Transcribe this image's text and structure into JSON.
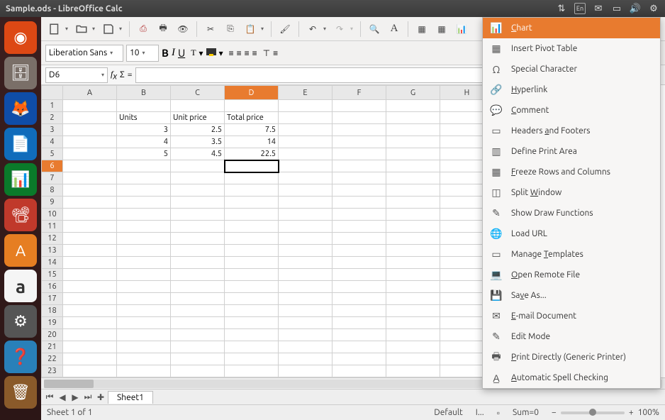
{
  "window_title": "Sample.ods - LibreOffice Calc",
  "sys_icons": [
    "network",
    "keyboard",
    "mail",
    "battery",
    "volume",
    "settings"
  ],
  "launcher": [
    {
      "name": "ubuntu",
      "bg": "#dd4814"
    },
    {
      "name": "files",
      "bg": "#7a6f68"
    },
    {
      "name": "firefox",
      "bg": "#0f4da8"
    },
    {
      "name": "writer",
      "bg": "#106cbb"
    },
    {
      "name": "calc",
      "bg": "#0a7a2a"
    },
    {
      "name": "impress",
      "bg": "#c0392b"
    },
    {
      "name": "software",
      "bg": "#e67e22"
    },
    {
      "name": "amazon",
      "bg": "#f5f5f5"
    },
    {
      "name": "settings",
      "bg": "#555"
    },
    {
      "name": "help",
      "bg": "#2980b9"
    },
    {
      "name": "trash",
      "bg": "#8a5a2a"
    }
  ],
  "font": {
    "name": "Liberation Sans",
    "size": "10"
  },
  "cell_ref": "D6",
  "columns": [
    "A",
    "B",
    "C",
    "D",
    "E",
    "F",
    "G",
    "H"
  ],
  "rows": 26,
  "active_col": "D",
  "active_row": 6,
  "cells": {
    "B2": {
      "v": "Units",
      "t": true
    },
    "C2": {
      "v": "Unit price",
      "t": true
    },
    "D2": {
      "v": "Total price",
      "t": true
    },
    "B3": {
      "v": "3"
    },
    "C3": {
      "v": "2.5"
    },
    "D3": {
      "v": "7.5"
    },
    "B4": {
      "v": "4"
    },
    "C4": {
      "v": "3.5"
    },
    "D4": {
      "v": "14"
    },
    "B5": {
      "v": "5"
    },
    "C5": {
      "v": "4.5"
    },
    "D5": {
      "v": "22.5"
    }
  },
  "sheet_tab": "Sheet1",
  "status": {
    "sheet": "Sheet 1 of 1",
    "style": "Default",
    "insert": "I...",
    "sum": "Sum=0",
    "zoom": "100%"
  },
  "menu": [
    {
      "icon": "📊",
      "label": "Chart",
      "u": 0,
      "active": true
    },
    {
      "icon": "▦",
      "label": "Insert Pivot Table"
    },
    {
      "icon": "Ω",
      "label": "Special Character"
    },
    {
      "icon": "🔗",
      "label": "Hyperlink",
      "u": 0
    },
    {
      "icon": "💬",
      "label": "Comment",
      "u": 0
    },
    {
      "icon": "▭",
      "label": "Headers and Footers",
      "u": 8
    },
    {
      "icon": "▥",
      "label": "Define Print Area"
    },
    {
      "icon": "▦",
      "label": "Freeze Rows and Columns",
      "u": 0
    },
    {
      "icon": "◫",
      "label": "Split Window",
      "u": 6
    },
    {
      "icon": "✎",
      "label": "Show Draw Functions"
    },
    {
      "icon": "🌐",
      "label": "Load URL"
    },
    {
      "icon": "▭",
      "label": "Manage Templates",
      "u": 7
    },
    {
      "icon": "💻",
      "label": "Open Remote File",
      "u": 0
    },
    {
      "icon": "💾",
      "label": "Save As...",
      "u": 2
    },
    {
      "icon": "✉",
      "label": "E-mail Document",
      "u": 0
    },
    {
      "icon": "✎",
      "label": "Edit Mode"
    },
    {
      "icon": "🖶",
      "label": "Print Directly (Generic Printer)",
      "u": 0
    },
    {
      "icon": "A̲",
      "label": "Automatic Spell Checking",
      "u": 0
    }
  ]
}
